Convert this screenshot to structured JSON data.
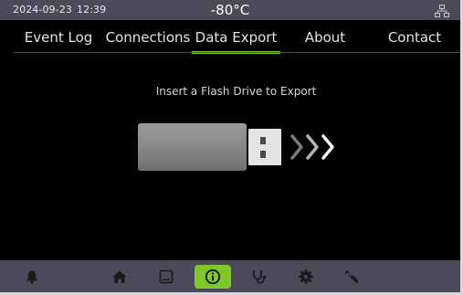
{
  "status": {
    "date": "2024-09-23",
    "time": "12:39",
    "temperature": "-80°C",
    "network_icon": "network-icon"
  },
  "tabs": [
    {
      "label": "Event Log",
      "active": false
    },
    {
      "label": "Connections",
      "active": false
    },
    {
      "label": "Data Export",
      "active": true
    },
    {
      "label": "About",
      "active": false
    },
    {
      "label": "Contact",
      "active": false
    }
  ],
  "main": {
    "prompt": "Insert a Flash Drive to Export",
    "illustration": "usb-flash-drive-icon"
  },
  "toolbar": {
    "items": [
      {
        "icon": "bell-icon",
        "active": false
      },
      {
        "icon": "home-icon",
        "active": false
      },
      {
        "icon": "display-icon",
        "active": false
      },
      {
        "icon": "info-icon",
        "active": true
      },
      {
        "icon": "stethoscope-icon",
        "active": false
      },
      {
        "icon": "gear-icon",
        "active": false
      },
      {
        "icon": "wrench-icon",
        "active": false
      }
    ]
  },
  "colors": {
    "accent": "#7ec82a",
    "bar_background": "#4a4a5a",
    "screen_background": "#000000",
    "text": "#e4e4e4"
  }
}
